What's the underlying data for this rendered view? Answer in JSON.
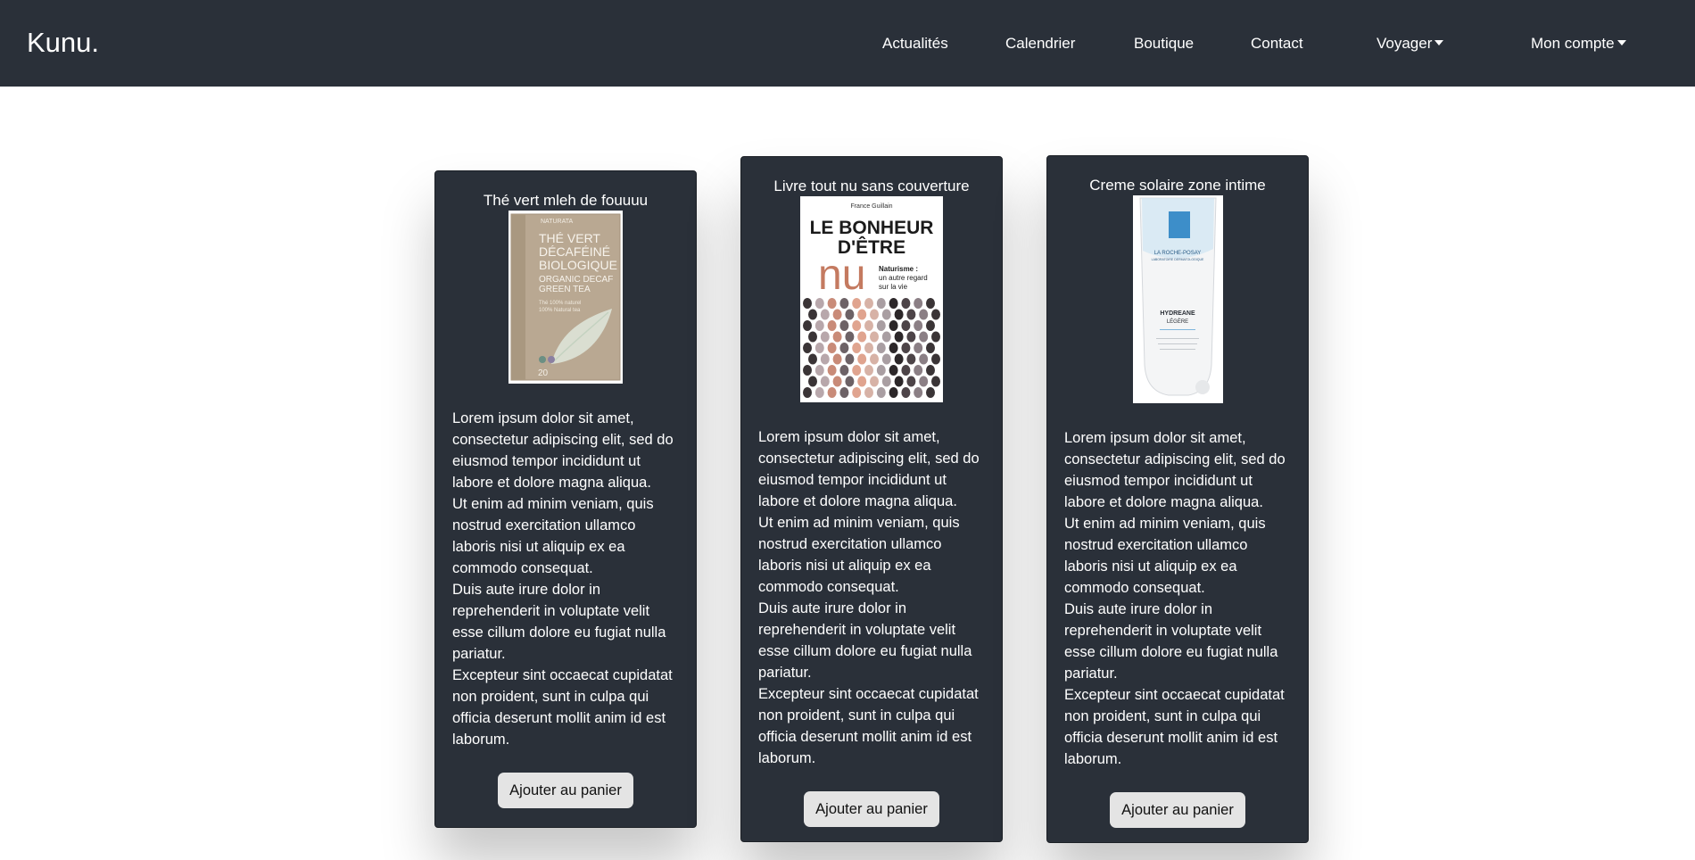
{
  "brand": "Kunu.",
  "nav": {
    "news": "Actualités",
    "calendar": "Calendrier",
    "shop": "Boutique",
    "contact": "Contact",
    "travel": "Voyager",
    "account": "Mon compte"
  },
  "products": [
    {
      "title": "Thé vert mleh de fouuuu",
      "image": {
        "brand": "NATURATA",
        "line1": "THÉ VERT",
        "line2": "DÉCAFÉINÉ",
        "line3": "BIOLOGIQUE",
        "line4": "ORGANIC DECAF",
        "line5": "GREEN TEA",
        "small1": "Thé 100% naturel",
        "small2": "100% Natural tea",
        "count": "20"
      },
      "paragraphs": [
        "Lorem ipsum dolor sit amet, consectetur adipiscing elit, sed do eiusmod tempor incididunt ut labore et dolore magna aliqua.",
        "Ut enim ad minim veniam, quis nostrud exercitation ullamco laboris nisi ut aliquip ex ea commodo consequat.",
        "Duis aute irure dolor in reprehenderit in voluptate velit esse cillum dolore eu fugiat nulla pariatur.",
        "Excepteur sint occaecat cupidatat non proident, sunt in culpa qui officia deserunt mollit anim id est laborum."
      ],
      "button": "Ajouter au panier"
    },
    {
      "title": "Livre tout nu sans couverture",
      "image": {
        "author": "France Guillain",
        "line1": "LE BONHEUR",
        "line2": "D'ÊTRE",
        "nu": "nu",
        "sub1": "Naturisme :",
        "sub2": "un autre regard",
        "sub3": "sur la vie"
      },
      "paragraphs": [
        "Lorem ipsum dolor sit amet, consectetur adipiscing elit, sed do eiusmod tempor incididunt ut labore et dolore magna aliqua.",
        "Ut enim ad minim veniam, quis nostrud exercitation ullamco laboris nisi ut aliquip ex ea commodo consequat.",
        "Duis aute irure dolor in reprehenderit in voluptate velit esse cillum dolore eu fugiat nulla pariatur.",
        "Excepteur sint occaecat cupidatat non proident, sunt in culpa qui officia deserunt mollit anim id est laborum."
      ],
      "button": "Ajouter au panier"
    },
    {
      "title": "Creme solaire zone intime",
      "image": {
        "brand": "LA ROCHE-POSAY",
        "lab": "LABORATOIRE DERMATOLOGIQUE",
        "name": "HYDREANE",
        "variant": "LÉGÈRE"
      },
      "paragraphs": [
        "Lorem ipsum dolor sit amet, consectetur adipiscing elit, sed do eiusmod tempor incididunt ut labore et dolore magna aliqua.",
        "Ut enim ad minim veniam, quis nostrud exercitation ullamco laboris nisi ut aliquip ex ea commodo consequat.",
        "Duis aute irure dolor in reprehenderit in voluptate velit esse cillum dolore eu fugiat nulla pariatur.",
        "Excepteur sint occaecat cupidatat non proident, sunt in culpa qui officia deserunt mollit anim id est laborum."
      ],
      "button": "Ajouter au panier"
    }
  ],
  "colors": {
    "navbar": "#2a3039",
    "card": "#2a3039",
    "button": "#e4e4e4"
  }
}
